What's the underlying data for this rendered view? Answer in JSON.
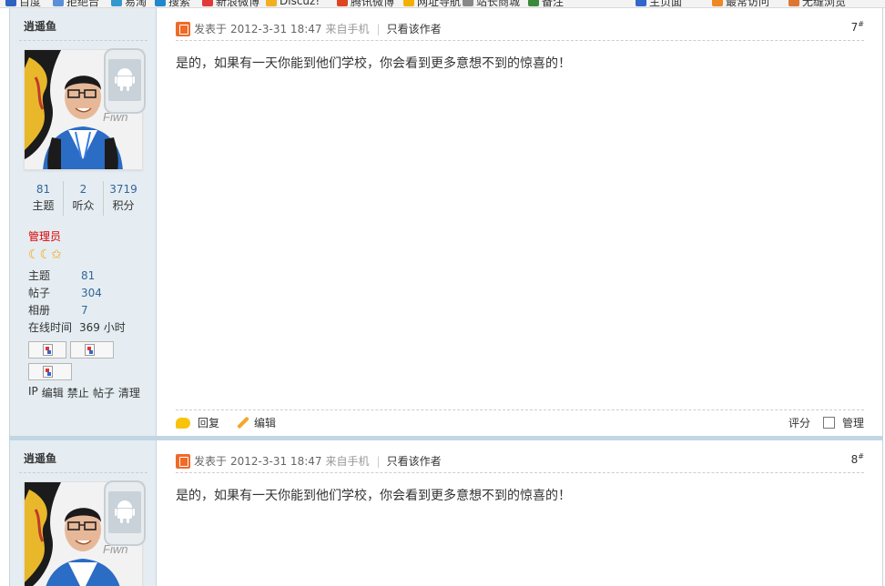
{
  "bookmarks": [
    {
      "label": "百度",
      "color": "#2d62c3"
    },
    {
      "label": "拒绝台",
      "color": "#5a8fd8"
    },
    {
      "label": "易淘",
      "color": "#3399cc"
    },
    {
      "label": "搜索",
      "color": "#2288cc"
    },
    {
      "label": "新浪微博",
      "color": "#e03a3a"
    },
    {
      "label": "Discuz!",
      "color": "#f0b020"
    },
    {
      "label": "腾讯微博",
      "color": "#dd4422"
    },
    {
      "label": "网址导航",
      "color": "#f3b000"
    },
    {
      "label": "站长商城",
      "color": "#888888"
    },
    {
      "label": "备注",
      "color": "#3a8a3a"
    },
    {
      "label": "主页面",
      "color": "#3366cc"
    },
    {
      "label": "最常访问",
      "color": "#ee8822"
    },
    {
      "label": "无缝浏览",
      "color": "#dd7733"
    }
  ],
  "colors": {
    "accent": "#336699",
    "role": "#dd0000",
    "side_bg": "#e5edf2",
    "border": "#c2d5e3"
  },
  "posts": [
    {
      "author": "逍遥鱼",
      "stats": [
        {
          "num": "81",
          "label": "主题"
        },
        {
          "num": "2",
          "label": "听众"
        },
        {
          "num": "3719",
          "label": "积分"
        }
      ],
      "role": "管理员",
      "stars_icon": "moon-moon-star",
      "info": [
        {
          "k": "主题",
          "v": "81"
        },
        {
          "k": "帖子",
          "v": "304"
        },
        {
          "k": "相册",
          "v": "7"
        }
      ],
      "online_label": "在线时间",
      "online_value": "369 小时",
      "admin_links": [
        "IP",
        "编辑",
        "禁止",
        "帖子",
        "清理"
      ],
      "posted_label": "发表于",
      "posted_time": "2012-3-31 18:47",
      "from": "来自手机",
      "only_author": "只看该作者",
      "floor": "7",
      "floor_sup": "#",
      "content": "是的，如果有一天你能到他们学校，你会看到更多意想不到的惊喜的！",
      "reply": "回复",
      "edit": "编辑",
      "rate": "评分",
      "manage": "管理"
    },
    {
      "author": "逍遥鱼",
      "posted_label": "发表于",
      "posted_time": "2012-3-31 18:47",
      "from": "来自手机",
      "only_author": "只看该作者",
      "floor": "8",
      "floor_sup": "#",
      "content": "是的，如果有一天你能到他们学校，你会看到更多意想不到的惊喜的！"
    }
  ]
}
